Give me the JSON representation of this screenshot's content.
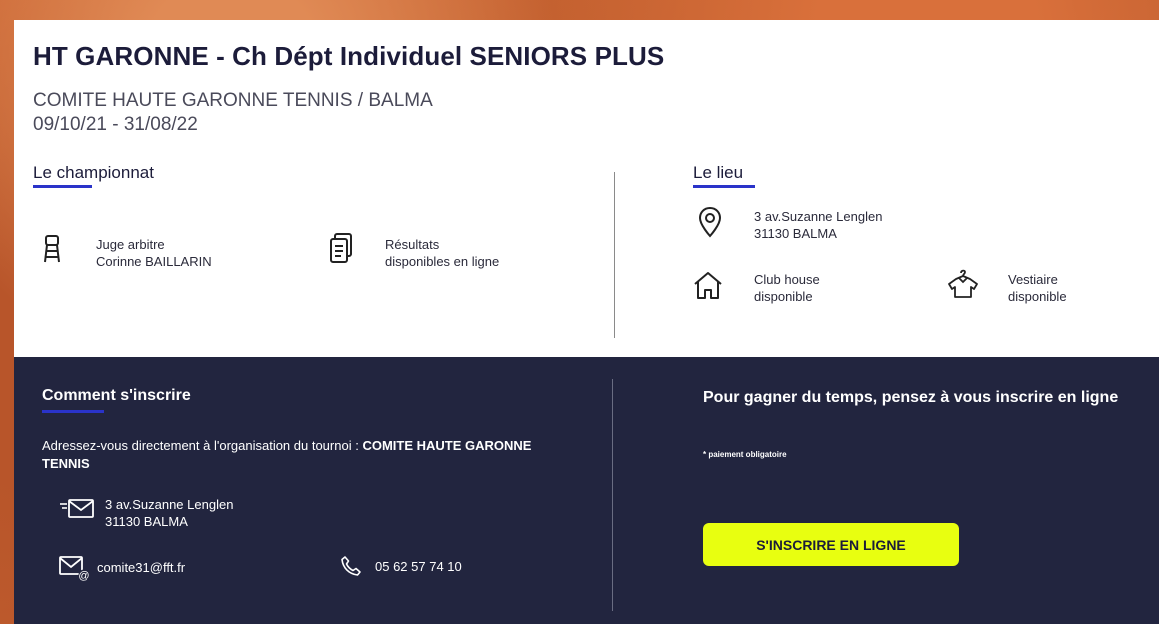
{
  "header": {
    "title": "HT GARONNE - Ch Dépt Individuel SENIORS PLUS",
    "organizer": "COMITE HAUTE GARONNE TENNIS / BALMA",
    "dates": "09/10/21 - 31/08/22"
  },
  "championnat": {
    "heading": "Le championnat",
    "referee": {
      "icon": "referee-chair-icon",
      "label": "Juge arbitre",
      "value": "Corinne BAILLARIN"
    },
    "results": {
      "icon": "document-icon",
      "line1": "Résultats",
      "line2": "disponibles en ligne"
    }
  },
  "lieu": {
    "heading": "Le lieu",
    "address": {
      "icon": "location-pin-icon",
      "line1": "3 av.Suzanne Lenglen",
      "line2": "31130 BALMA"
    },
    "clubhouse": {
      "icon": "house-icon",
      "line1": "Club house",
      "line2": "disponible"
    },
    "vestiaire": {
      "icon": "shirt-hanger-icon",
      "line1": "Vestiaire",
      "line2": "disponible"
    }
  },
  "inscription": {
    "heading": "Comment s'inscrire",
    "intro": "Adressez-vous directement à l'organisation du tournoi : ",
    "organization": "COMITE HAUTE GARONNE TENNIS",
    "mail_address": {
      "icon": "mail-send-icon",
      "line1": "3 av.Suzanne Lenglen",
      "line2": "31130 BALMA"
    },
    "email": {
      "icon": "email-at-icon",
      "value": "comite31@fft.fr"
    },
    "phone": {
      "icon": "phone-icon",
      "value": "05 62 57 74 10"
    }
  },
  "online": {
    "heading": "Pour gagner du temps, pensez à vous inscrire en ligne",
    "note": "* paiement obligatoire",
    "button_label": "S'INSCRIRE EN LIGNE"
  },
  "colors": {
    "accent_blue": "#2a33c9",
    "dark_panel": "#22253f",
    "button_yellow": "#e8ff10",
    "background_orange": "#c4622f"
  }
}
